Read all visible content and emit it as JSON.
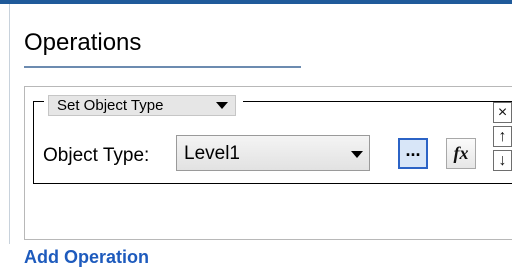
{
  "section": {
    "title": "Operations"
  },
  "operation": {
    "type_label": "Set Object Type",
    "field_label": "Object Type:",
    "field_value": "Level1",
    "browse_label": "...",
    "fx_label": "fx",
    "remove_symbol": "×",
    "move_up_symbol": "↑",
    "move_down_symbol": "↓"
  },
  "footer": {
    "add_operation_label": "Add Operation"
  },
  "colors": {
    "accent": "#1f5a9a",
    "link": "#1e5bbd",
    "browse_border": "#2b63c6"
  }
}
